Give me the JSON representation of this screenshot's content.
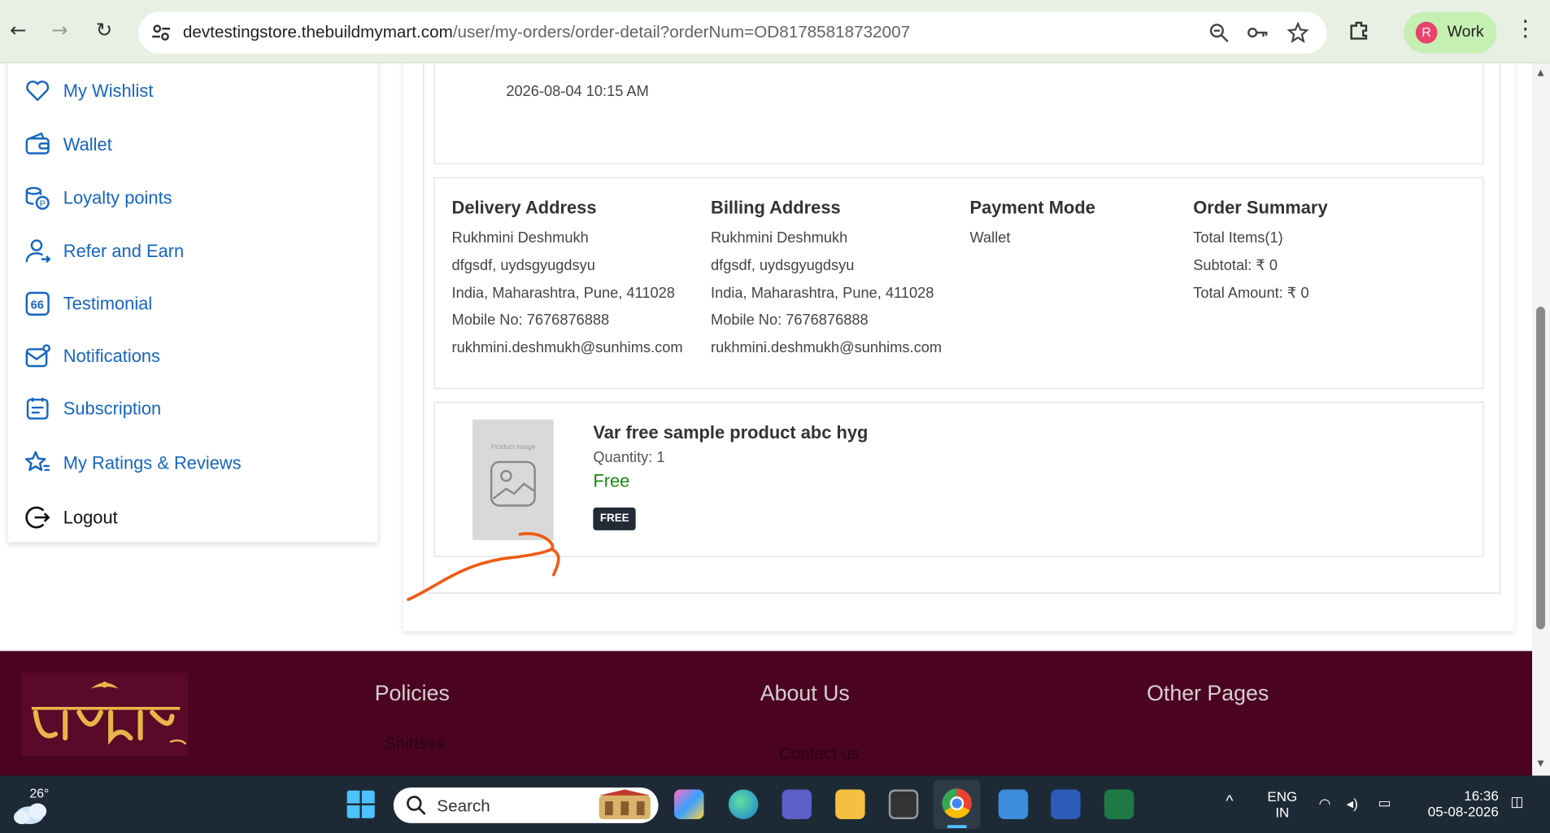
{
  "browser": {
    "url_host": "devtestingstore.thebuildmymart.com",
    "url_path": "/user/my-orders/order-detail?orderNum=OD81785818732007",
    "profile_initial": "R",
    "profile_name": "Work"
  },
  "sidebar": {
    "items": [
      {
        "label": "My Wishlist",
        "icon": "heart-icon"
      },
      {
        "label": "Wallet",
        "icon": "wallet-icon"
      },
      {
        "label": "Loyalty points",
        "icon": "coins-icon"
      },
      {
        "label": "Refer and Earn",
        "icon": "user-share-icon"
      },
      {
        "label": "Testimonial",
        "icon": "quote-icon"
      },
      {
        "label": "Notifications",
        "icon": "mail-icon"
      },
      {
        "label": "Subscription",
        "icon": "calendar-icon"
      },
      {
        "label": "My Ratings & Reviews",
        "icon": "star-icon"
      },
      {
        "label": "Logout",
        "icon": "logout-icon"
      }
    ]
  },
  "order": {
    "date": "2026-08-04 10:15 AM",
    "delivery": {
      "title": "Delivery Address",
      "name": "Rukhmini Deshmukh",
      "line1": "dfgsdf, uydsgyugdsyu",
      "line2": "India, Maharashtra, Pune, 411028",
      "mobile": "Mobile No: 7676876888",
      "email": "rukhmini.deshmukh@sunhims.com"
    },
    "billing": {
      "title": "Billing Address",
      "name": "Rukhmini Deshmukh",
      "line1": "dfgsdf, uydsgyugdsyu",
      "line2": "India, Maharashtra, Pune, 411028",
      "mobile": "Mobile No: 7676876888",
      "email": "rukhmini.deshmukh@sunhims.com"
    },
    "payment": {
      "title": "Payment Mode",
      "mode": "Wallet"
    },
    "summary": {
      "title": "Order Summary",
      "items": "Total Items(1)",
      "subtotal": "Subtotal: ₹ 0",
      "total": "Total Amount: ₹ 0"
    },
    "product": {
      "image_caption": "Product image",
      "name": "Var free sample product abc hyg",
      "quantity": "Quantity: 1",
      "price": "Free",
      "badge": "FREE"
    }
  },
  "footer": {
    "policies": "Policies",
    "about": "About Us",
    "other": "Other Pages",
    "link1": "Shirtsss",
    "link2": "Contact us"
  },
  "taskbar": {
    "temperature": "26°",
    "search": "Search",
    "lang1": "ENG",
    "lang2": "IN",
    "time": "16:36",
    "date": "05-08-2026"
  },
  "colors": {
    "link": "#1565c0",
    "free": "#188a12",
    "footer": "#4a0420",
    "annotation": "#f05a14"
  }
}
